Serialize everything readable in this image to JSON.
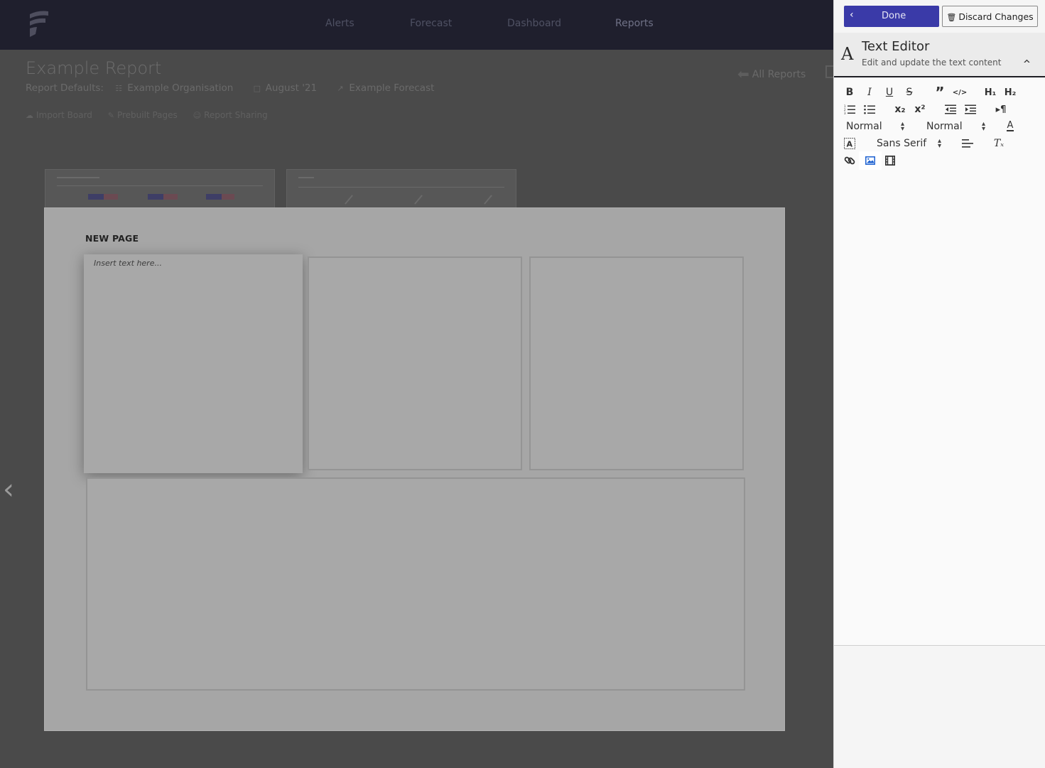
{
  "nav": {
    "items": [
      "Alerts",
      "Forecast",
      "Dashboard",
      "Reports"
    ]
  },
  "report": {
    "title": "Example Report",
    "defaults_label": "Report Defaults:",
    "organisation": "Example Organisation",
    "period": "August '21",
    "forecast": "Example Forecast",
    "all_reports": "All Reports",
    "actions": [
      "Import Board",
      "Prebuilt Pages",
      "Report Sharing"
    ]
  },
  "page": {
    "title": "NEW PAGE",
    "text_placeholder": "Insert text here..."
  },
  "panel": {
    "done_label": "Done",
    "discard_label": "Discard Changes",
    "editor_title": "Text Editor",
    "editor_subtitle": "Edit and update the text content",
    "header_select": "Normal",
    "size_select": "Normal",
    "font_select": "Sans Serif",
    "toolbar": {
      "bold": "B",
      "italic": "I",
      "underline": "U",
      "strike": "S",
      "quote": "”",
      "code": "</>",
      "h1": "H₁",
      "h2": "H₂",
      "sub": "x₂",
      "sup": "x²",
      "rtl": "▸¶",
      "clean": "Tₓ",
      "color": "A"
    }
  },
  "colors": {
    "accent": "#3a3aa8",
    "topbar": "#1f1f2d",
    "image_icon": "#1a5fd0"
  }
}
